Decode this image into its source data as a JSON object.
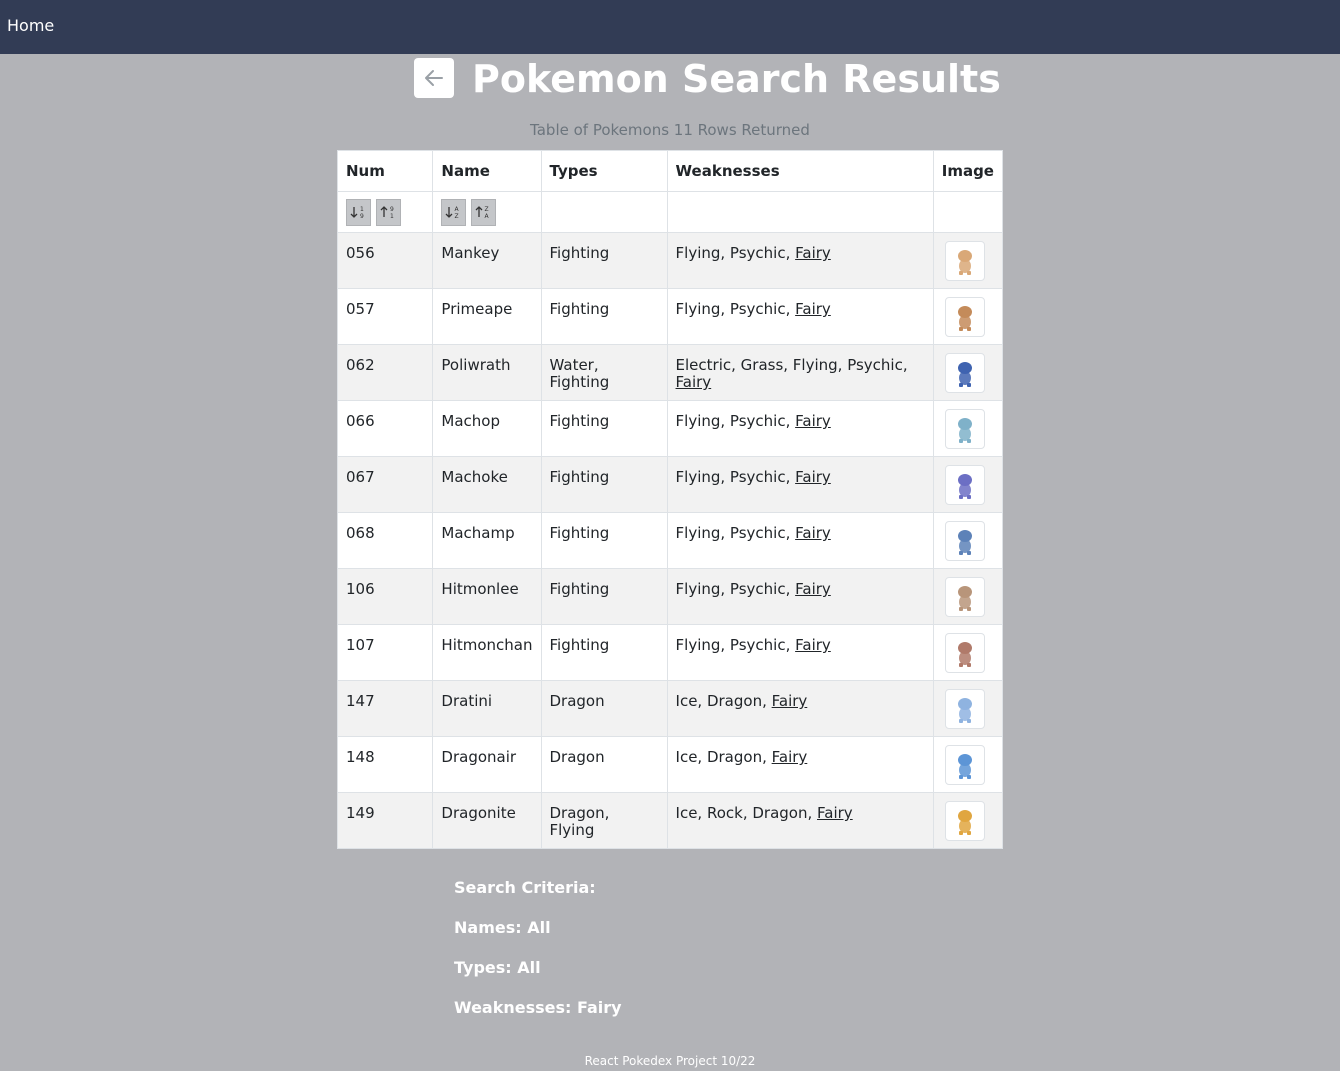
{
  "nav": {
    "home_label": "Home"
  },
  "header": {
    "title": "Pokemon Search Results",
    "subtitle": "Table of Pokemons 11 Rows Returned"
  },
  "table": {
    "columns": [
      "Num",
      "Name",
      "Types",
      "Weaknesses",
      "Image"
    ],
    "rows": [
      {
        "num": "056",
        "name": "Mankey",
        "types": "Fighting",
        "weak": "Flying, Psychic, ",
        "weak_link": "Fairy",
        "icon": "mankey-image",
        "color": "#d9a877"
      },
      {
        "num": "057",
        "name": "Primeape",
        "types": "Fighting",
        "weak": "Flying, Psychic, ",
        "weak_link": "Fairy",
        "icon": "primeape-image",
        "color": "#c48b5a"
      },
      {
        "num": "062",
        "name": "Poliwrath",
        "types": "Water, Fighting",
        "weak": "Electric, Grass, Flying, Psychic, ",
        "weak_link": "Fairy",
        "icon": "poliwrath-image",
        "color": "#3f63b0"
      },
      {
        "num": "066",
        "name": "Machop",
        "types": "Fighting",
        "weak": "Flying, Psychic, ",
        "weak_link": "Fairy",
        "icon": "machop-image",
        "color": "#7fb1c9"
      },
      {
        "num": "067",
        "name": "Machoke",
        "types": "Fighting",
        "weak": "Flying, Psychic, ",
        "weak_link": "Fairy",
        "icon": "machoke-image",
        "color": "#6c6fc4"
      },
      {
        "num": "068",
        "name": "Machamp",
        "types": "Fighting",
        "weak": "Flying, Psychic, ",
        "weak_link": "Fairy",
        "icon": "machamp-image",
        "color": "#5d82b8"
      },
      {
        "num": "106",
        "name": "Hitmonlee",
        "types": "Fighting",
        "weak": "Flying, Psychic, ",
        "weak_link": "Fairy",
        "icon": "hitmonlee-image",
        "color": "#b8957a"
      },
      {
        "num": "107",
        "name": "Hitmonchan",
        "types": "Fighting",
        "weak": "Flying, Psychic, ",
        "weak_link": "Fairy",
        "icon": "hitmonchan-image",
        "color": "#b07a6a"
      },
      {
        "num": "147",
        "name": "Dratini",
        "types": "Dragon",
        "weak": "Ice, Dragon, ",
        "weak_link": "Fairy",
        "icon": "dratini-image",
        "color": "#8fb3e0"
      },
      {
        "num": "148",
        "name": "Dragonair",
        "types": "Dragon",
        "weak": "Ice, Dragon, ",
        "weak_link": "Fairy",
        "icon": "dragonair-image",
        "color": "#5d95d6"
      },
      {
        "num": "149",
        "name": "Dragonite",
        "types": "Dragon, Flying",
        "weak": "Ice, Rock, Dragon, ",
        "weak_link": "Fairy",
        "icon": "dragonite-image",
        "color": "#e0a640"
      }
    ]
  },
  "criteria": {
    "heading": "Search Criteria:",
    "names": "Names: All",
    "types": "Types: All",
    "weaknesses": "Weaknesses: Fairy"
  },
  "footer": {
    "text": "React Pokedex Project 10/22"
  },
  "colors": {
    "navbar": "#323c55",
    "background": "#b2b3b7",
    "subtitle": "#6c757d"
  }
}
